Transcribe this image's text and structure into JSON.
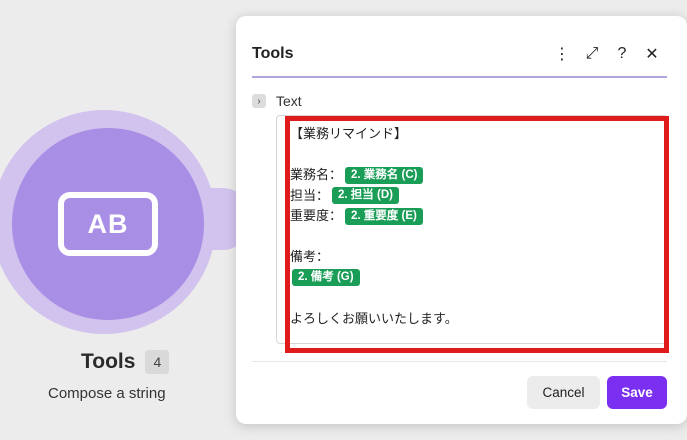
{
  "module": {
    "icon_text": "AB",
    "name": "Tools",
    "badge": "4",
    "subtitle": "Compose a string"
  },
  "panel": {
    "title": "Tools",
    "header_icons": {
      "menu": "⋮",
      "expand": "⤢",
      "help": "?",
      "close": "✕"
    },
    "field": {
      "toggle": "›",
      "label": "Text"
    },
    "text_lines": [
      {
        "text": "【業務リマインド】",
        "pill": ""
      },
      {
        "text": "",
        "pill": ""
      },
      {
        "text": "業務名：",
        "pill": "2. 業務名 (C)"
      },
      {
        "text": "担当：",
        "pill": "2. 担当 (D)"
      },
      {
        "text": "重要度：",
        "pill": "2. 重要度 (E)"
      },
      {
        "text": "",
        "pill": ""
      },
      {
        "text": "備考：",
        "pill": ""
      },
      {
        "text": "",
        "pill": "2. 備考 (G)"
      },
      {
        "text": "",
        "pill": ""
      },
      {
        "text": "よろしくお願いいたします。",
        "pill": ""
      }
    ],
    "buttons": {
      "cancel": "Cancel",
      "save": "Save"
    }
  },
  "colors": {
    "module_fill": "#a98ee6",
    "module_halo": "#d2c2ee",
    "pill": "#1a9e57",
    "highlight": "#e01b1b",
    "save_button": "#7b2ff0"
  }
}
